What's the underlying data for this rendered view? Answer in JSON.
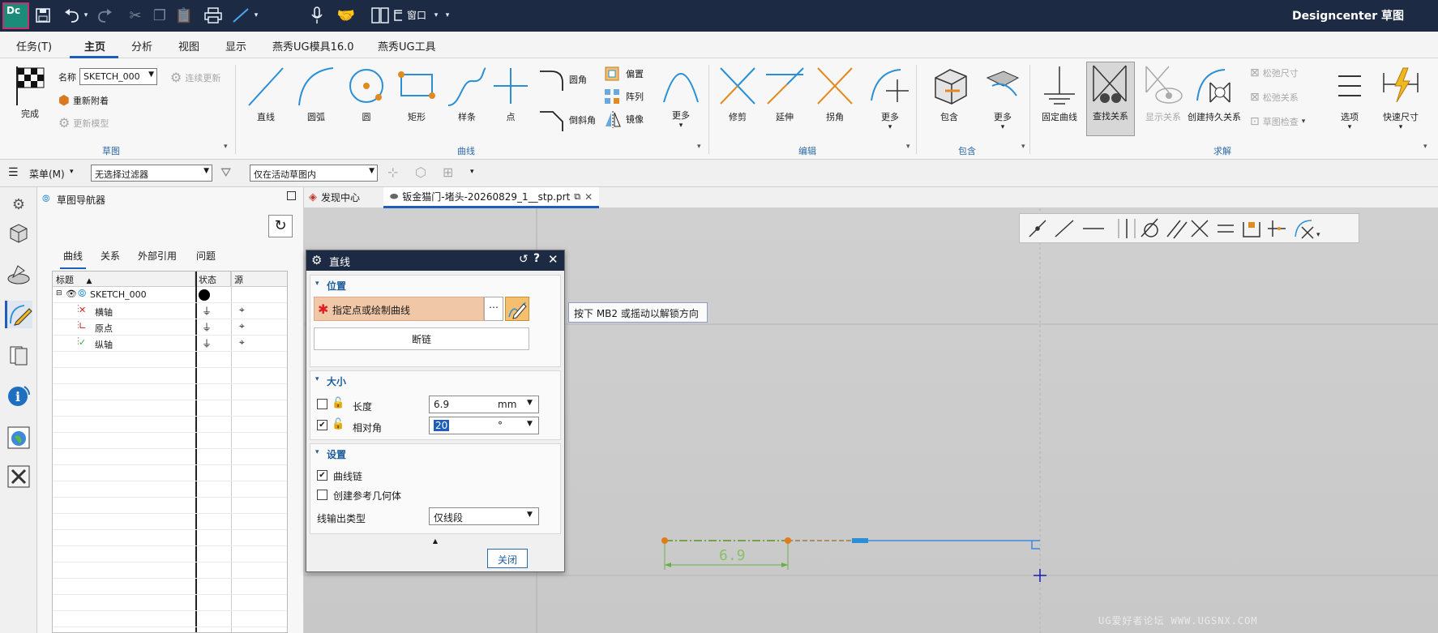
{
  "app": {
    "logo": "Dc",
    "title": "Designcenter  草图",
    "window_menu": "窗口"
  },
  "tabs": [
    "任务(T)",
    "主页",
    "分析",
    "视图",
    "显示",
    "燕秀UG模具16.0",
    "燕秀UG工具"
  ],
  "active_tab": "主页",
  "ribbon": {
    "sketch_group": {
      "finish": "完成",
      "name_label": "名称",
      "name_value": "SKETCH_000",
      "reattach": "重新附着",
      "update_model": "更新模型",
      "continuous_update": "连续更新",
      "label": "草图"
    },
    "curve_group": {
      "line": "直线",
      "arc": "圆弧",
      "circle": "圆",
      "rectangle": "矩形",
      "spline": "样条",
      "point": "点",
      "fillet": "圆角",
      "chamfer": "倒斜角",
      "offset": "偏置",
      "pattern": "阵列",
      "mirror": "镜像",
      "more": "更多",
      "label": "曲线"
    },
    "edit_group": {
      "trim": "修剪",
      "extend": "延伸",
      "corner": "拐角",
      "more": "更多",
      "label": "编辑"
    },
    "include_group": {
      "include": "包含",
      "more": "更多",
      "label": "包含"
    },
    "solve_group": {
      "fix_curve": "固定曲线",
      "find_relations": "查找关系",
      "show_relations": "显示关系",
      "create_persistent": "创建持久关系",
      "relax_dims": "松弛尺寸",
      "relax_relations": "松弛关系",
      "sketch_check": "草图检查",
      "options": "选项",
      "rapid_dimension": "快速尺寸",
      "label": "求解"
    }
  },
  "filterbar": {
    "menu": "菜单(M)",
    "filter": "无选择过滤器",
    "scope": "仅在活动草图内"
  },
  "navigator": {
    "title": "草图导航器",
    "tabs": [
      "曲线",
      "关系",
      "外部引用",
      "问题"
    ],
    "columns": [
      "标题",
      "状态",
      "源"
    ],
    "rows": [
      {
        "name": "SKETCH_000"
      },
      {
        "name": "横轴"
      },
      {
        "name": "原点"
      },
      {
        "name": "纵轴"
      }
    ]
  },
  "doc_tabs": [
    "发现中心",
    "钣金猫门-堵头-20260829_1__stp.prt"
  ],
  "dialog": {
    "title": "直线",
    "position": {
      "heading": "位置",
      "prompt": "指定点或绘制曲线",
      "break_chain": "断链"
    },
    "size": {
      "heading": "大小",
      "length_label": "长度",
      "length_value": "6.9",
      "length_unit": "mm",
      "angle_label": "相对角",
      "angle_value": "20",
      "angle_unit": "°"
    },
    "settings": {
      "heading": "设置",
      "curve_chain": "曲线链",
      "create_reference": "创建参考几何体",
      "output_label": "线输出类型",
      "output_value": "仅线段"
    },
    "close": "关闭"
  },
  "tooltip": "按下 MB2 或摇动以解锁方向",
  "canvas": {
    "dimension_text": "6.9"
  },
  "watermark": "UG爱好者论坛 WWW.UGSNX.COM",
  "colors": {
    "title_bar": "#1d2a44",
    "accent": "#1e5db8",
    "prompt_bg": "#f0c8a8",
    "curve_orange": "#e07a1a",
    "curve_blue": "#1a7fd8"
  }
}
